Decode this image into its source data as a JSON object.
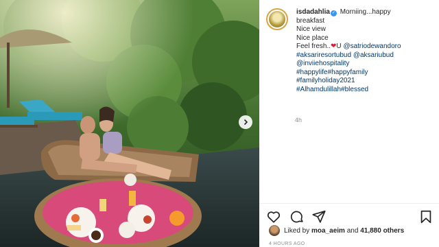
{
  "post": {
    "username": "isdadahlia",
    "caption_lines": [
      "Morniing...happy",
      "breakfast",
      "Nice view",
      "Nice place",
      "Feel fresh.."
    ],
    "caption_after_heart": "U",
    "mention_1": "@satriodewandoro",
    "tags_line_1a": "#aksariresortubud",
    "tags_line_1b": "@aksariubud",
    "mention_2": "@inviiehospitality",
    "tags_line_3": "#happylife#happyfamily",
    "tags_line_4": "#familyholiday2021",
    "tags_line_5": "#Alhamdulillah#blessed",
    "relative_time": "4h",
    "liked_by_prefix": "Liked by",
    "liked_by_user": "moa_aeim",
    "liked_by_and": "and",
    "likes_count": "41,880 others",
    "timestamp": "4 HOURS AGO"
  },
  "icons": {
    "like": "heart-outline-icon",
    "comment": "comment-bubble-icon",
    "share": "paper-plane-icon",
    "save": "bookmark-icon",
    "next": "chevron-right-icon",
    "verified": "verified-badge-icon"
  },
  "colors": {
    "link": "#00376b",
    "heart": "#d81e3a",
    "muted": "#8e8e8e",
    "verified": "#3897f0"
  }
}
